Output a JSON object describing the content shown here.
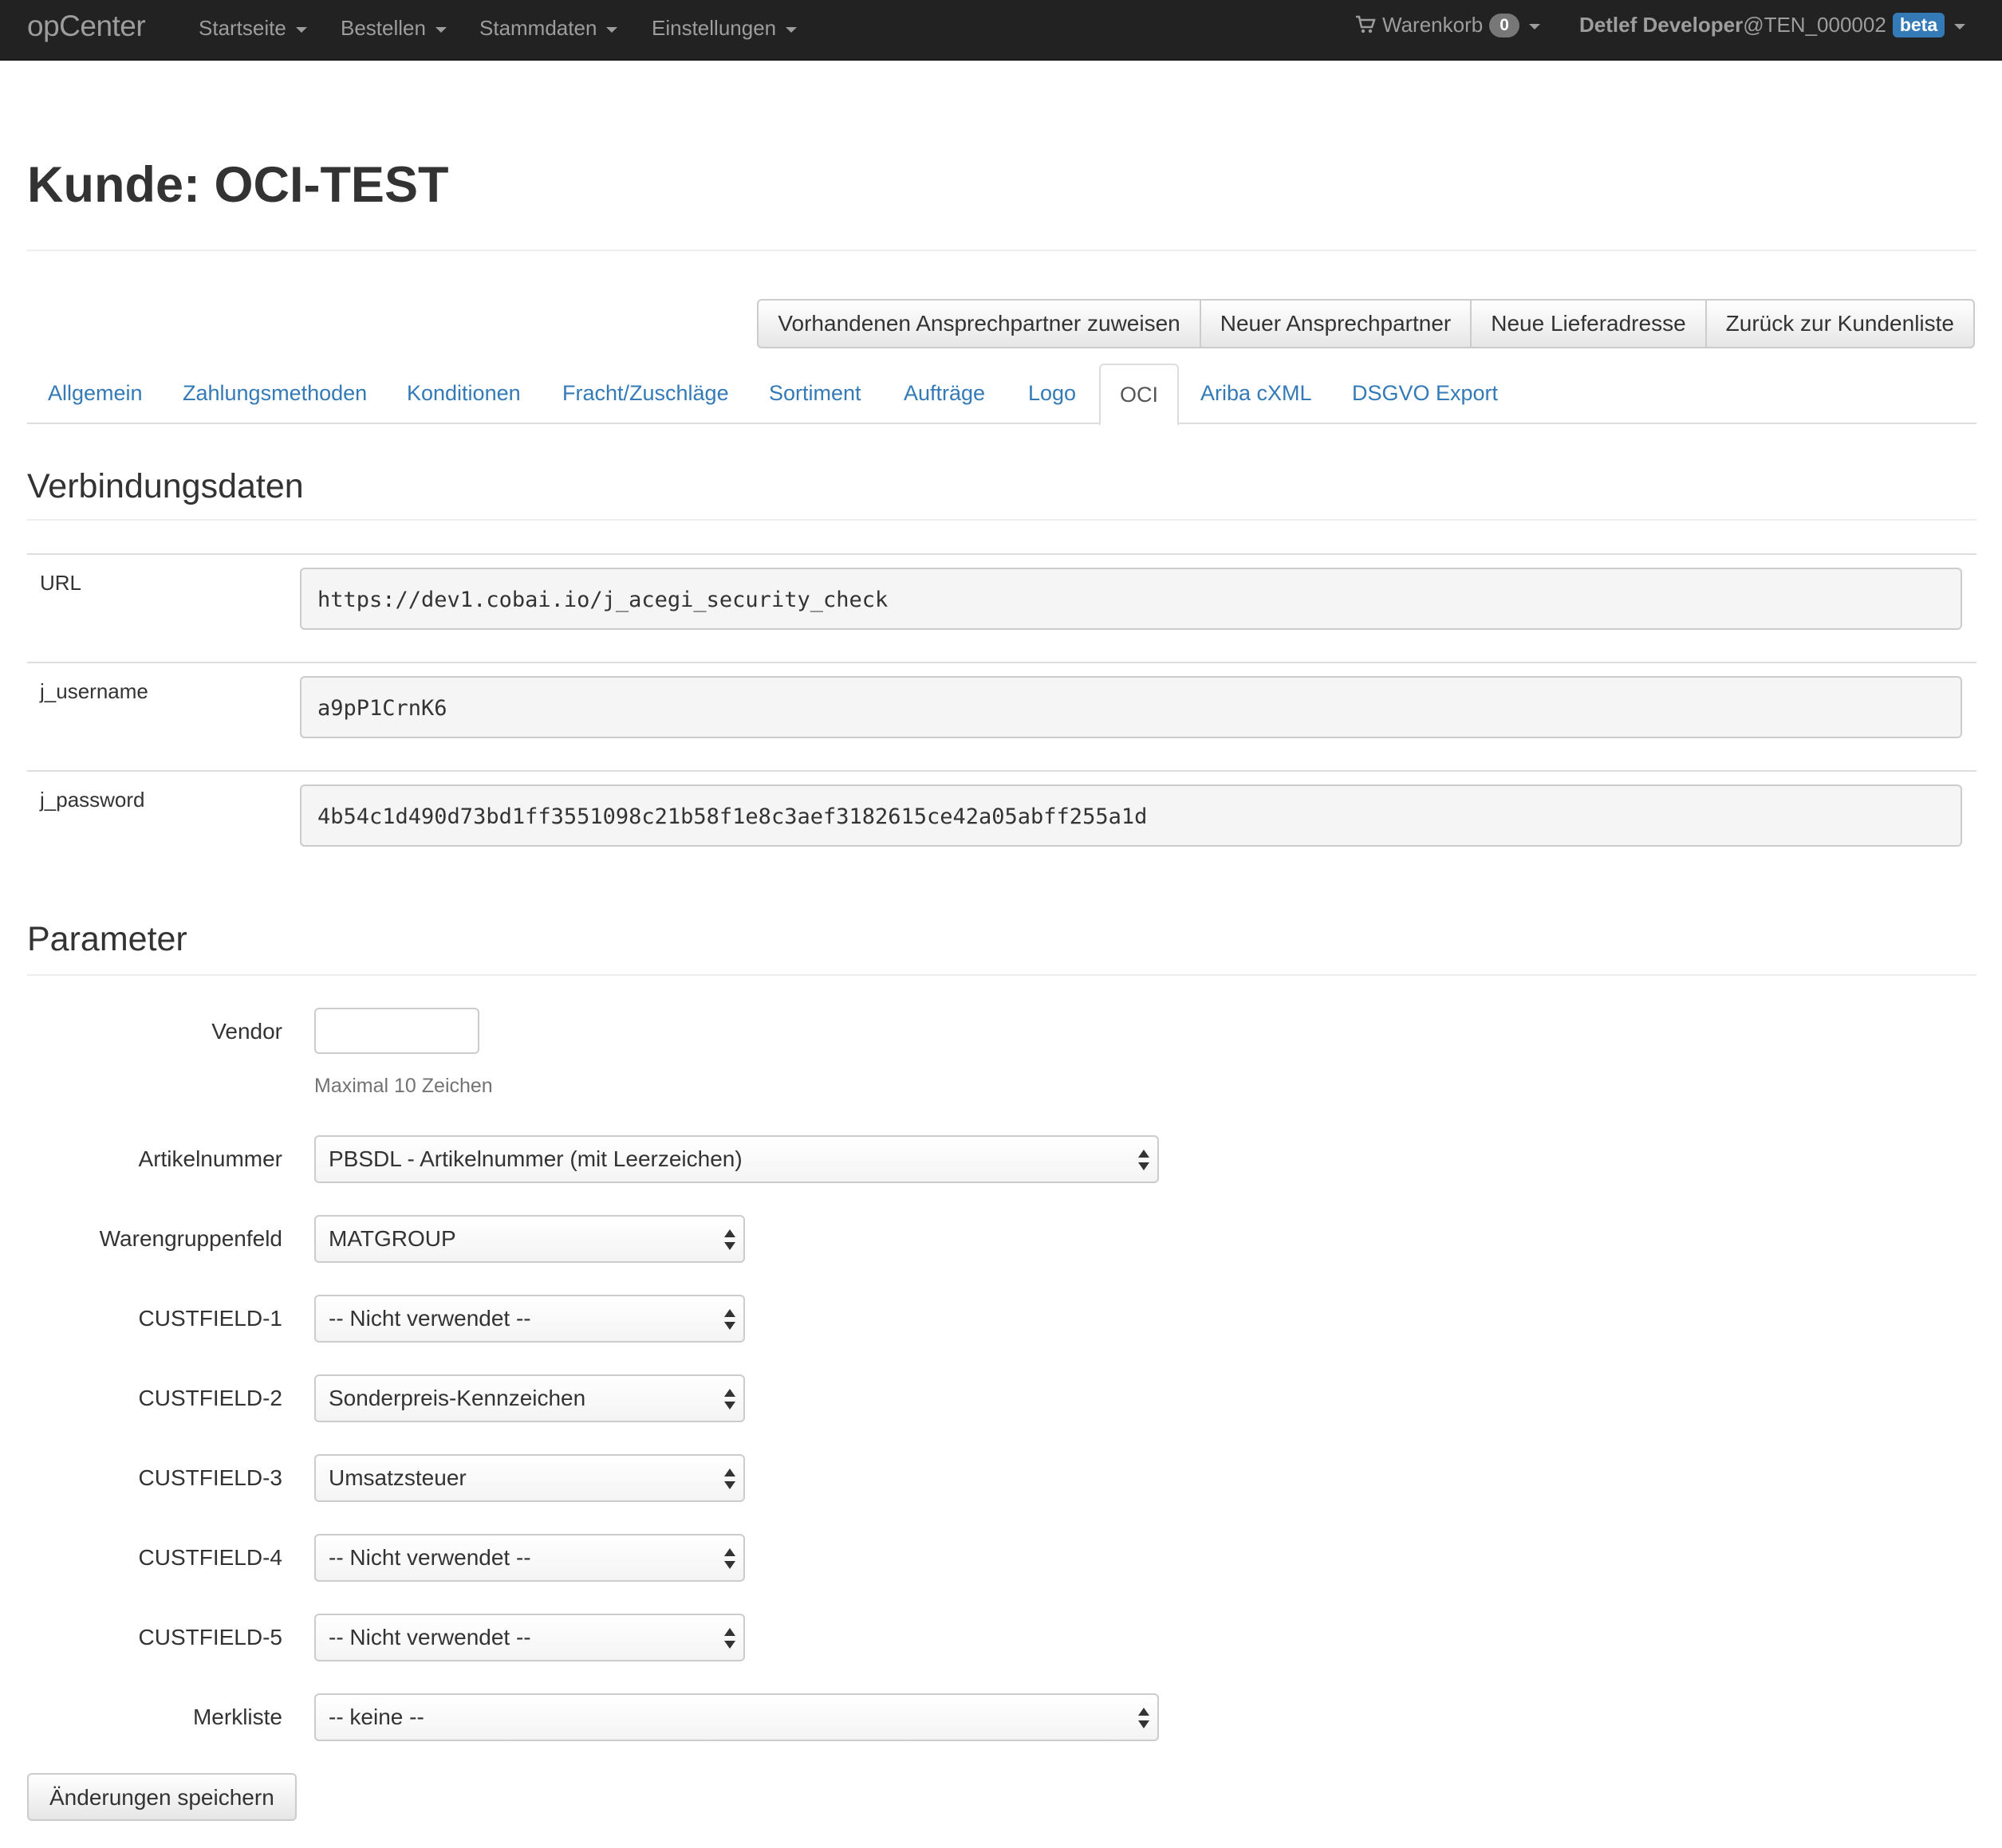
{
  "navbar": {
    "brand": "opCenter",
    "menu": [
      {
        "label": "Startseite"
      },
      {
        "label": "Bestellen"
      },
      {
        "label": "Stammdaten"
      },
      {
        "label": "Einstellungen"
      }
    ],
    "cart_label": "Warenkorb",
    "cart_count": "0",
    "user_name": "Detlef Developer",
    "user_tenant": "@TEN_000002",
    "beta_label": "beta"
  },
  "page": {
    "title": "Kunde: OCI-TEST"
  },
  "actions": {
    "assign_contact": "Vorhandenen Ansprechpartner zuweisen",
    "new_contact": "Neuer Ansprechpartner",
    "new_address": "Neue Lieferadresse",
    "back_to_list": "Zurück zur Kundenliste"
  },
  "tabs": [
    {
      "label": "Allgemein",
      "active": false
    },
    {
      "label": "Zahlungsmethoden",
      "active": false
    },
    {
      "label": "Konditionen",
      "active": false
    },
    {
      "label": "Fracht/Zuschläge",
      "active": false
    },
    {
      "label": "Sortiment",
      "active": false
    },
    {
      "label": "Aufträge",
      "active": false
    },
    {
      "label": "Logo",
      "active": false
    },
    {
      "label": "OCI",
      "active": true
    },
    {
      "label": "Ariba cXML",
      "active": false
    },
    {
      "label": "DSGVO Export",
      "active": false
    }
  ],
  "connection": {
    "heading": "Verbindungsdaten",
    "rows": [
      {
        "label": "URL",
        "value": "https://dev1.cobai.io/j_acegi_security_check"
      },
      {
        "label": "j_username",
        "value": "a9pP1CrnK6"
      },
      {
        "label": "j_password",
        "value": "4b54c1d490d73bd1ff3551098c21b58f1e8c3aef3182615ce42a05abff255a1d"
      }
    ]
  },
  "parameters": {
    "heading": "Parameter",
    "vendor": {
      "label": "Vendor",
      "value": "",
      "help": "Maximal 10 Zeichen"
    },
    "artikelnummer": {
      "label": "Artikelnummer",
      "selected": "PBSDL - Artikelnummer (mit Leerzeichen)"
    },
    "warengruppenfeld": {
      "label": "Warengruppenfeld",
      "selected": "MATGROUP"
    },
    "custfield1": {
      "label": "CUSTFIELD-1",
      "selected": "-- Nicht verwendet --"
    },
    "custfield2": {
      "label": "CUSTFIELD-2",
      "selected": "Sonderpreis-Kennzeichen"
    },
    "custfield3": {
      "label": "CUSTFIELD-3",
      "selected": "Umsatzsteuer"
    },
    "custfield4": {
      "label": "CUSTFIELD-4",
      "selected": "-- Nicht verwendet --"
    },
    "custfield5": {
      "label": "CUSTFIELD-5",
      "selected": "-- Nicht verwendet --"
    },
    "merkliste": {
      "label": "Merkliste",
      "selected": "-- keine --"
    },
    "save_label": "Änderungen speichern"
  },
  "colors": {
    "navbar_bg": "#222222",
    "link": "#337ab7",
    "beta_badge": "#337ab7",
    "cart_badge": "#777777"
  },
  "icons": {
    "cart": "shopping-cart-icon"
  }
}
